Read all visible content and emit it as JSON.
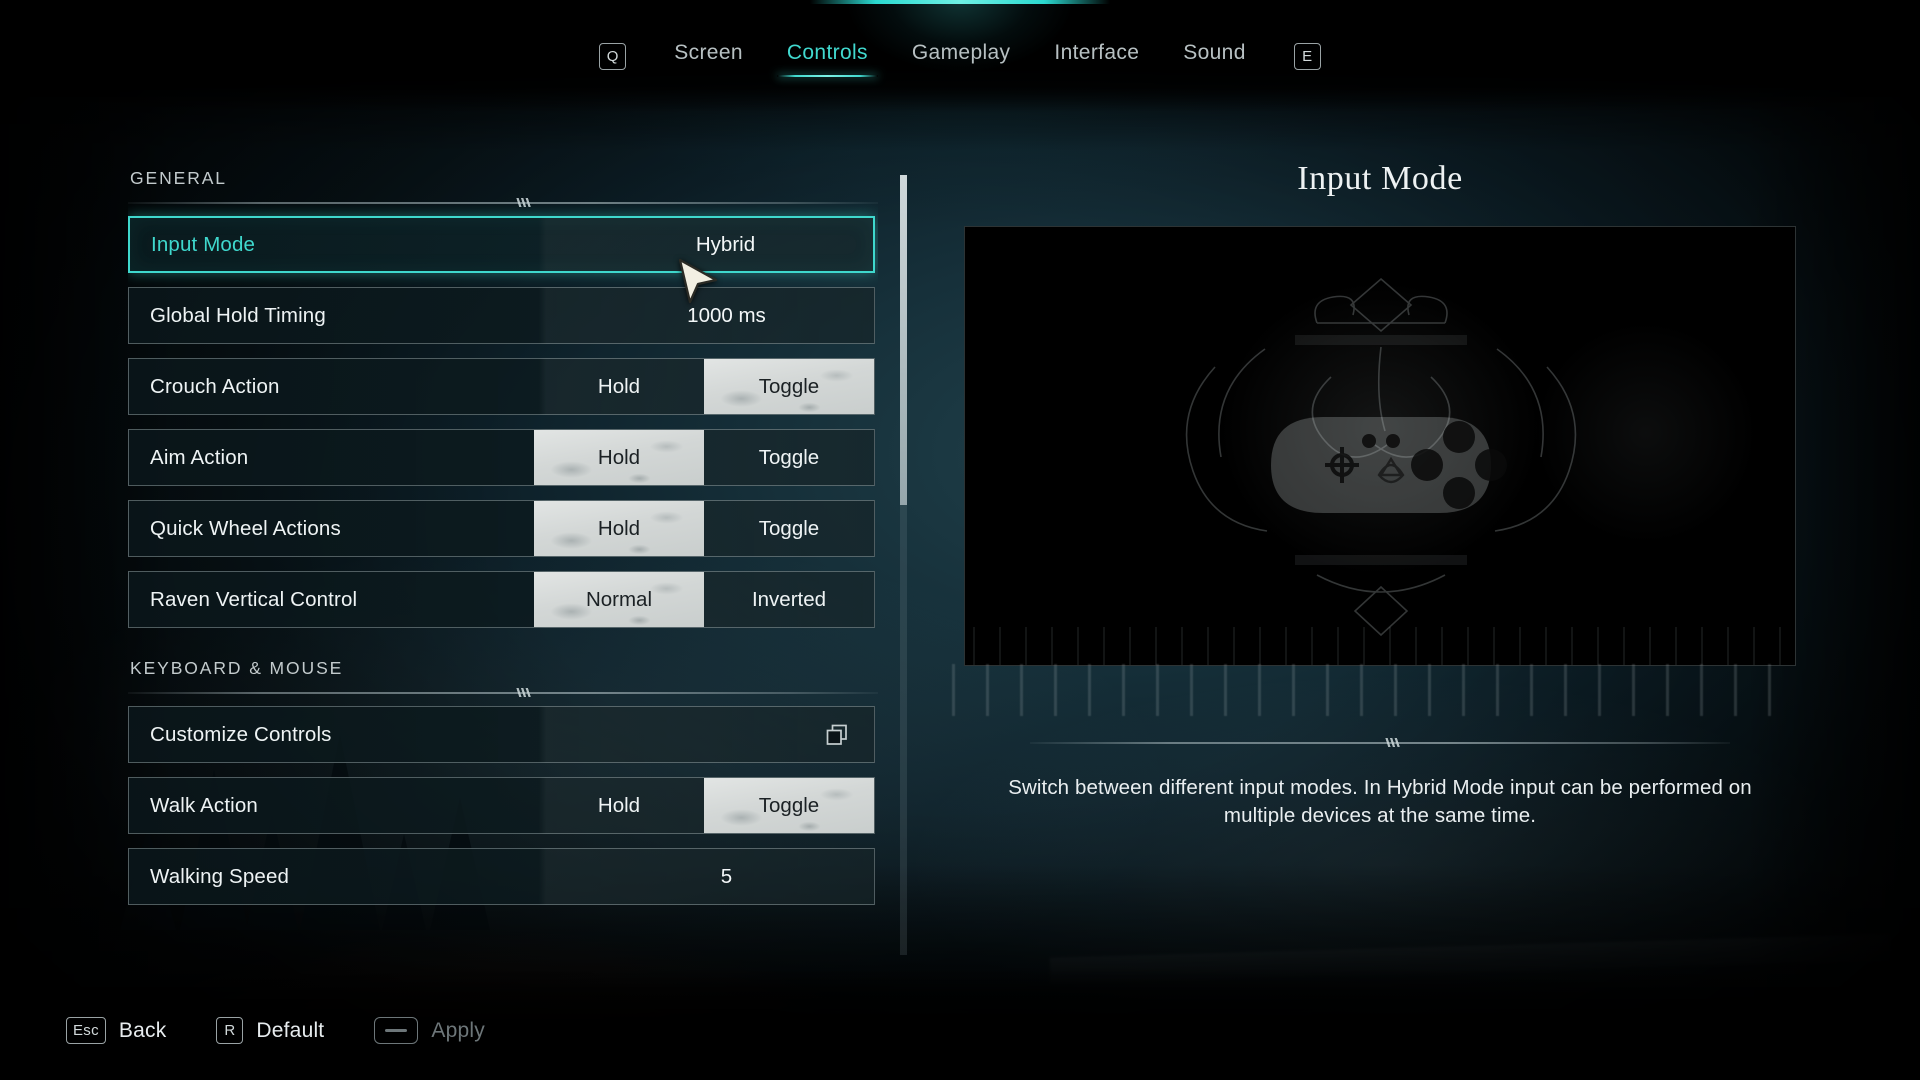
{
  "topbar": {
    "prev_key": "Q",
    "next_key": "E",
    "tabs": [
      {
        "label": "Screen",
        "active": false
      },
      {
        "label": "Controls",
        "active": true
      },
      {
        "label": "Gameplay",
        "active": false
      },
      {
        "label": "Interface",
        "active": false
      },
      {
        "label": "Sound",
        "active": false
      }
    ]
  },
  "settings": {
    "groups": [
      {
        "title": "GENERAL",
        "rows": [
          {
            "label": "Input Mode",
            "type": "value",
            "value": "Hybrid",
            "selected": true
          },
          {
            "label": "Global Hold Timing",
            "type": "value",
            "value": "1000 ms",
            "selected": false
          },
          {
            "label": "Crouch Action",
            "type": "segment",
            "options": [
              "Hold",
              "Toggle"
            ],
            "selected_option": "Toggle",
            "selected": false
          },
          {
            "label": "Aim Action",
            "type": "segment",
            "options": [
              "Hold",
              "Toggle"
            ],
            "selected_option": "Hold",
            "selected": false
          },
          {
            "label": "Quick Wheel Actions",
            "type": "segment",
            "options": [
              "Hold",
              "Toggle"
            ],
            "selected_option": "Hold",
            "selected": false
          },
          {
            "label": "Raven Vertical Control",
            "type": "segment",
            "options": [
              "Normal",
              "Inverted"
            ],
            "selected_option": "Normal",
            "selected": false
          }
        ]
      },
      {
        "title": "KEYBOARD & MOUSE",
        "rows": [
          {
            "label": "Customize Controls",
            "type": "action",
            "icon": "open-submenu-icon",
            "selected": false
          },
          {
            "label": "Walk Action",
            "type": "segment",
            "options": [
              "Hold",
              "Toggle"
            ],
            "selected_option": "Toggle",
            "selected": false
          },
          {
            "label": "Walking Speed",
            "type": "value",
            "value": "5",
            "selected": false
          }
        ]
      }
    ]
  },
  "detail": {
    "title": "Input Mode",
    "preview_icon": "gamepad-emblem",
    "description": "Switch between different input modes. In Hybrid Mode input can be performed on multiple devices at the same time."
  },
  "footer": {
    "buttons": [
      {
        "key": "Esc",
        "label": "Back",
        "key_style": "cap",
        "disabled": false
      },
      {
        "key": "R",
        "label": "Default",
        "key_style": "cap",
        "disabled": false
      },
      {
        "key": "",
        "label": "Apply",
        "key_style": "spacebar",
        "disabled": true
      }
    ]
  },
  "colors": {
    "accent": "#3fd8cd",
    "text": "#eef3f4",
    "muted": "#6d7679",
    "selected_segment_bg": "#d3d7d6"
  }
}
